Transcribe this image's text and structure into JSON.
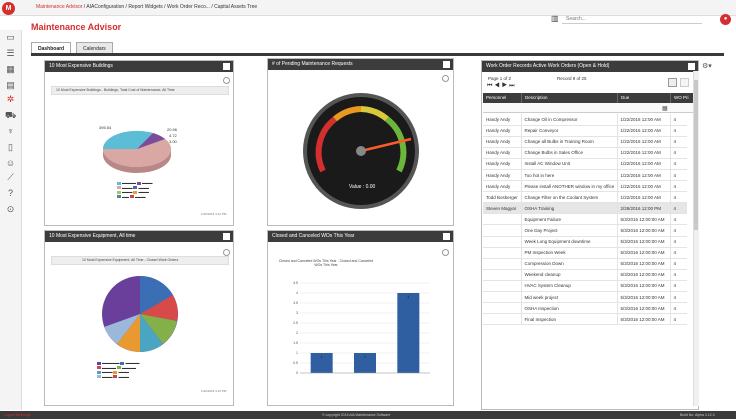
{
  "app": {
    "logo": "M",
    "title": "Maintenance Advisor"
  },
  "breadcrumb": {
    "home": "Maintenance Advisor",
    "items": [
      "AIAConfiguration",
      "Report Widgets",
      "Work Order Reco...",
      "Capital Assets Tree"
    ]
  },
  "search": {
    "placeholder": "Search..."
  },
  "tabs": [
    {
      "label": "Dashboard"
    },
    {
      "label": "Calendars"
    }
  ],
  "widgets": {
    "buildings": {
      "title": "10 Most Expensive Buildings",
      "chart_title": "10 Most Expensive Buildings - Buildings, Total Cost of Maintenance, All Time",
      "timestamp": "1/26/2016 4:12 PM"
    },
    "requests": {
      "title": "# of Pending Maintenance Requests",
      "gauge_value": "Value : 0.00"
    },
    "equipment": {
      "title": "10 Most Expensive Equipment, All time",
      "chart_title": "10 Most Expensive Equipment, All Time - Closed Work Orders",
      "timestamp": "1/26/2016 4:12 PM"
    },
    "closed": {
      "title": "Closed and Canceled WOs This Year",
      "chart_title": "Closed and Canceled WOs This Year - Closed and Canceled WOs This Year"
    },
    "workorders": {
      "title": "Work Order Records Active Work Orders (Open & Hold)",
      "page_info": "Page 1 of 2",
      "record_info": "Record 9 of 25",
      "columns": [
        "Personnel",
        "Description",
        "Due",
        "WO Pri"
      ],
      "rows": [
        [
          "Handy Andy",
          "Change Oil in Compressor",
          "1/22/2016 12:00 AM",
          "4"
        ],
        [
          "Handy Andy",
          "Repair Conveyor",
          "1/22/2016 12:00 AM",
          "4"
        ],
        [
          "Handy Andy",
          "Change all Bulbs in Training Room",
          "1/22/2016 12:00 AM",
          "4"
        ],
        [
          "Handy Andy",
          "Change Bulbs in Sales Office",
          "1/22/2016 12:00 AM",
          "4"
        ],
        [
          "Handy Andy",
          "Install AC Window Unit",
          "1/22/2016 12:00 AM",
          "4"
        ],
        [
          "Handy Andy",
          "Too hot in here",
          "1/22/2016 12:00 AM",
          "4"
        ],
        [
          "Handy Andy",
          "Please install ANOTHER window in my office",
          "1/22/2016 12:00 AM",
          "4"
        ],
        [
          "Todd Bosberger",
          "Change Filter on the Coolant System",
          "1/22/2016 12:00 AM",
          "4"
        ],
        [
          "Steven Magyar",
          "OSHA Training",
          "2/28/2016 12:00 PM",
          "4"
        ],
        [
          "",
          "Equipment Failure",
          "5/3/2016 12:00:00 AM",
          "4"
        ],
        [
          "",
          "One Day Project",
          "5/3/2016 12:00:00 AM",
          "4"
        ],
        [
          "",
          "Week Long Equipment downtime",
          "5/3/2016 12:00:00 AM",
          "4"
        ],
        [
          "",
          "PM Inspection Week",
          "5/3/2016 12:00:00 AM",
          "4"
        ],
        [
          "",
          "Compression Down",
          "5/3/2016 12:00:00 AM",
          "4"
        ],
        [
          "",
          "Weekend cleanup",
          "5/3/2016 12:00:00 AM",
          "4"
        ],
        [
          "",
          "HVAC System Cleanup",
          "5/3/2016 12:00:00 AM",
          "4"
        ],
        [
          "",
          "Mid week project",
          "5/3/2016 12:00:00 AM",
          "4"
        ],
        [
          "",
          "OSHA Inspection",
          "5/3/2016 12:00:00 AM",
          "4"
        ],
        [
          "",
          "Final Inspection",
          "5/3/2016 12:00:00 AM",
          "4"
        ]
      ]
    }
  },
  "footer": {
    "left": "Logout  Webpage",
    "center": "© copyright 2016 AiA Maintenance Software",
    "right": "Build No: Alpha 4.12.0"
  },
  "chart_data": [
    {
      "type": "pie",
      "title": "10 Most Expensive Buildings - Buildings, Total Cost of Maintenance, All Time",
      "series": [
        {
          "values": [
            395.54,
            20.96,
            4.72,
            3.0
          ]
        }
      ],
      "data_labels": [
        "395.54",
        "20.96",
        "4.72",
        "3.00"
      ]
    },
    {
      "type": "pie",
      "title": "10 Most Expensive Equipment, All Time - Closed Work Orders",
      "series": [
        {
          "values": [
            30,
            15,
            12,
            10,
            8,
            7,
            6,
            5,
            4,
            3
          ]
        }
      ]
    },
    {
      "type": "bar",
      "title": "Closed and Canceled WOs This Year - Closed and Canceled WOs This Year",
      "categories": [
        "",
        "",
        ""
      ],
      "values": [
        1,
        1,
        4
      ],
      "ylim": [
        0,
        4.5
      ],
      "yticks": [
        "0",
        "0.5",
        "1",
        "1.5",
        "2",
        "2.5",
        "3",
        "3.5",
        "4",
        "4.5"
      ]
    }
  ],
  "colors": {
    "accent": "#d32f2f",
    "header": "#3c3c3c",
    "bar": "#2f5fa0"
  }
}
